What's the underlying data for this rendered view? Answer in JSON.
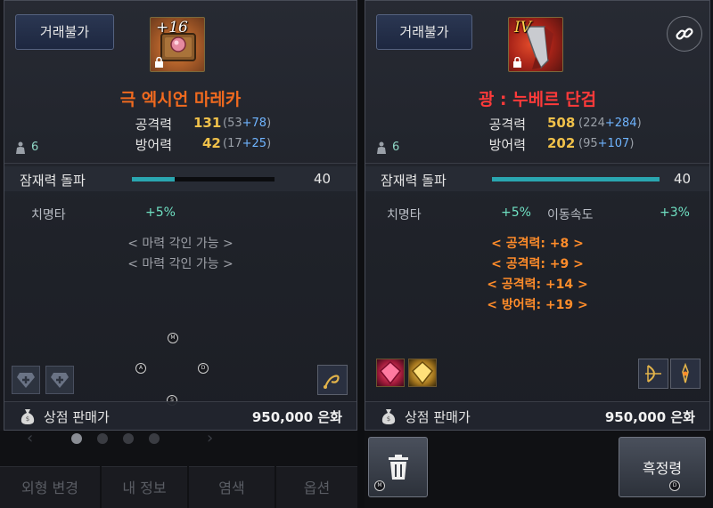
{
  "left_item": {
    "trade_label": "거래불가",
    "grade": "+16",
    "name": "극 엑시언 마레카",
    "attack_label": "공격력",
    "attack_value": "131",
    "attack_breakdown_open": "(53",
    "attack_breakdown_plus": "+78",
    "attack_breakdown_close": ")",
    "defense_label": "방어력",
    "defense_value": "42",
    "defense_breakdown_open": "(17",
    "defense_breakdown_plus": "+25",
    "defense_breakdown_close": ")",
    "person_count": "6",
    "potential_label": "잠재력 돌파",
    "potential_value": "40",
    "potential_fill": 0.3,
    "options": [
      {
        "label": "치명타",
        "value": "+5%"
      }
    ],
    "engrave_lines": [
      "< 마력 각인 가능 >",
      "< 마력 각인 가능 >"
    ],
    "sale_label": "상점 판매가",
    "sale_value": "950,000 은화",
    "key_hints": [
      "M",
      "A",
      "D",
      "S"
    ]
  },
  "right_item": {
    "trade_label": "거래불가",
    "grade": "IV",
    "name": "광 : 누베르 단검",
    "attack_label": "공격력",
    "attack_value": "508",
    "attack_breakdown_open": "(224",
    "attack_breakdown_plus": "+284",
    "attack_breakdown_close": ")",
    "defense_label": "방어력",
    "defense_value": "202",
    "defense_breakdown_open": "(95",
    "defense_breakdown_plus": "+107",
    "defense_breakdown_close": ")",
    "person_count": "6",
    "potential_label": "잠재력 돌파",
    "potential_value": "40",
    "potential_fill": 1.0,
    "options": [
      {
        "label": "치명타",
        "value": "+5%"
      },
      {
        "label": "이동속도",
        "value": "+3%"
      }
    ],
    "bonus_lines": [
      "< 공격력: +8 >",
      "< 공격력: +9 >",
      "< 공격력: +14 >",
      "< 방어력: +19 >"
    ],
    "sale_label": "상점 판매가",
    "sale_value": "950,000 은화",
    "action_button": "흑정령",
    "key_hints": [
      "M",
      "D"
    ]
  },
  "background_tabs": [
    "외형 변경",
    "내 정보",
    "염색",
    "옵션"
  ],
  "colors": {
    "orange_name": "#f06a1f",
    "red_name": "#ff3a3a",
    "stat_gold": "#f0c14a",
    "option_teal": "#6fe0c2",
    "bonus_orange": "#ff8c2a",
    "bar_teal": "#2aa6b0"
  }
}
